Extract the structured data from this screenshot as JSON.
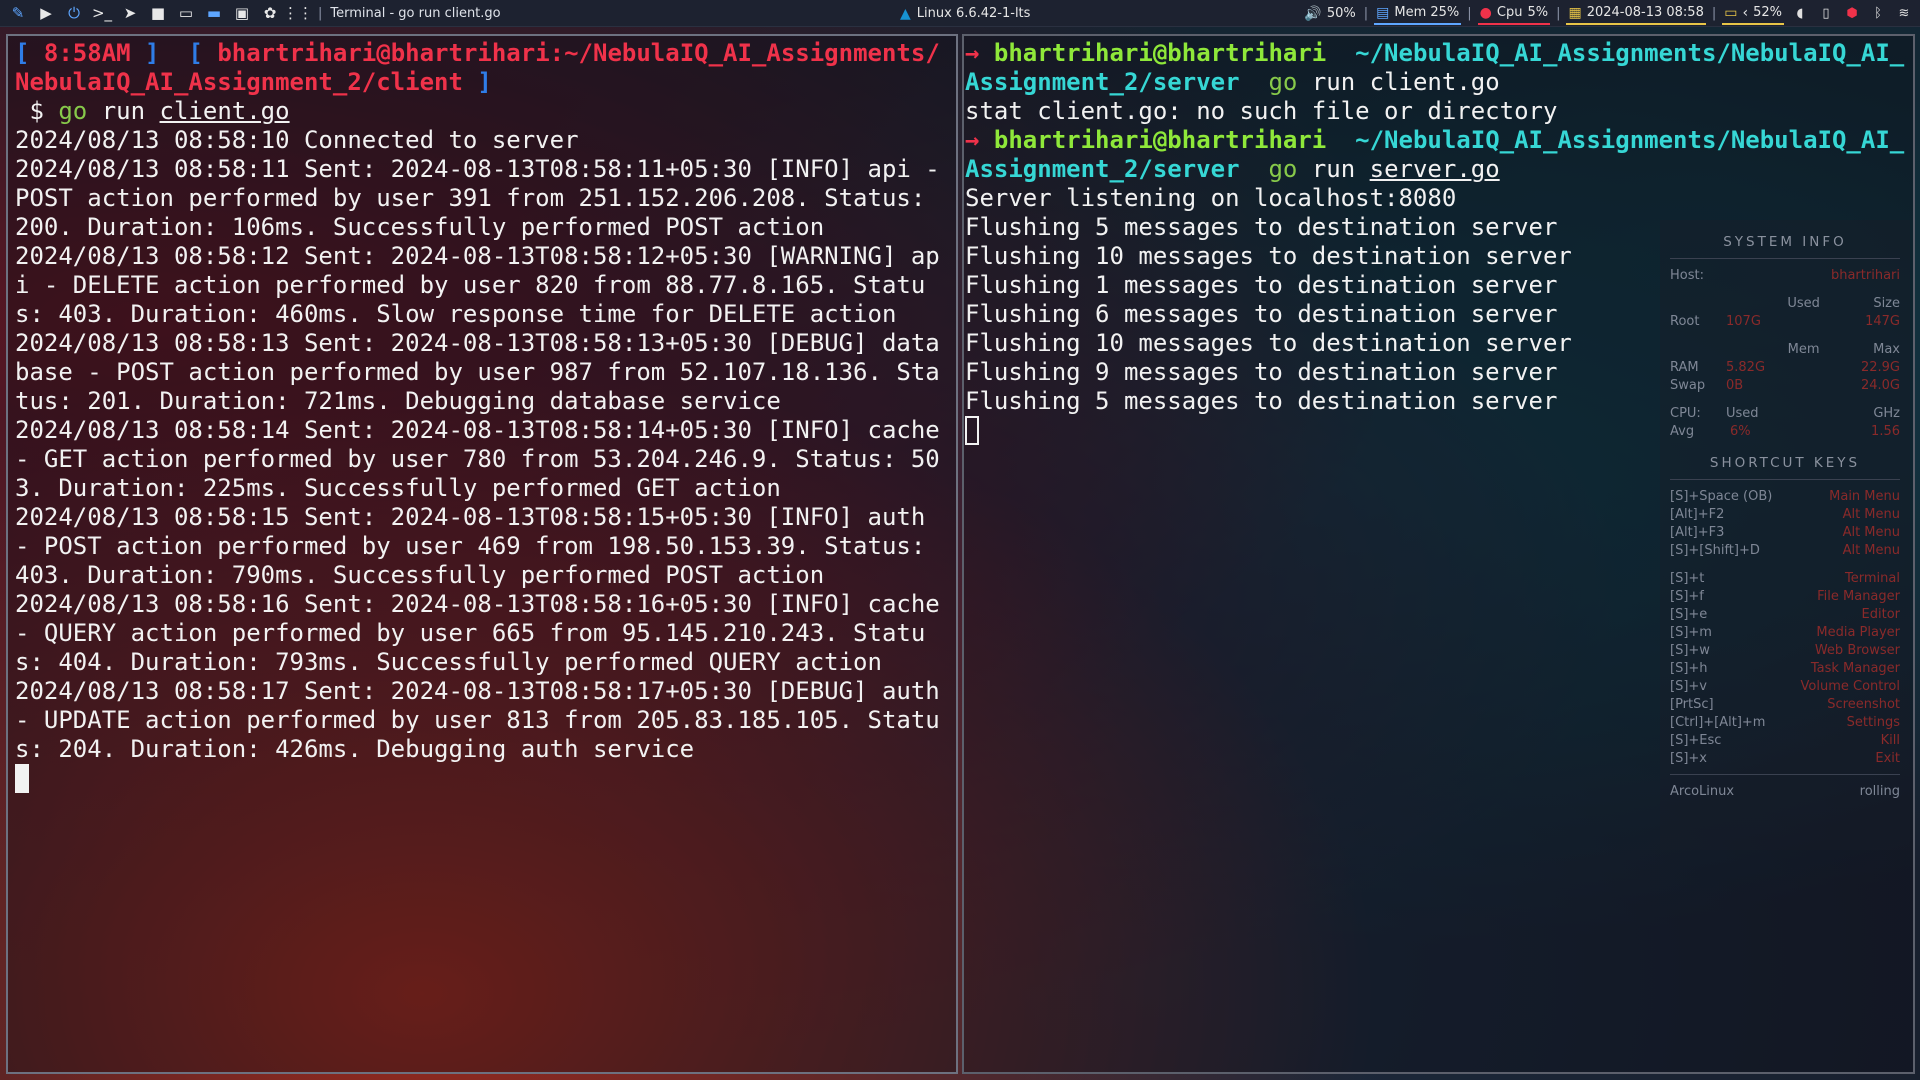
{
  "panel": {
    "window_title": "Terminal - go run client.go",
    "kernel": "Linux 6.6.42-1-lts",
    "volume": "50%",
    "mem": "Mem 25%",
    "cpu_label": "Cpu",
    "cpu_value": "5%",
    "datetime": "2024-08-13 08:58",
    "battery": "52%",
    "mem_color": "#5ea6ff",
    "cpu_color": "#f0324a",
    "date_color": "#e8c547",
    "battery_color": "#e8c547"
  },
  "left_terminal": {
    "prompt_time": "8:58AM",
    "prompt_path": "bhartrihari@bhartrihari:~/NebulaIQ_AI_Assignments/NebulaIQ_AI_Assignment_2/client",
    "prompt_symbol": "$",
    "cmd_go": "go",
    "cmd_run": "run",
    "cmd_file": "client.go",
    "lines": [
      "2024/08/13 08:58:10 Connected to server",
      "2024/08/13 08:58:11 Sent: 2024-08-13T08:58:11+05:30 [INFO] api - POST action performed by user 391 from 251.152.206.208. Status: 200. Duration: 106ms. Successfully performed POST action",
      "2024/08/13 08:58:12 Sent: 2024-08-13T08:58:12+05:30 [WARNING] api - DELETE action performed by user 820 from 88.77.8.165. Status: 403. Duration: 460ms. Slow response time for DELETE action",
      "2024/08/13 08:58:13 Sent: 2024-08-13T08:58:13+05:30 [DEBUG] database - POST action performed by user 987 from 52.107.18.136. Status: 201. Duration: 721ms. Debugging database service",
      "2024/08/13 08:58:14 Sent: 2024-08-13T08:58:14+05:30 [INFO] cache - GET action performed by user 780 from 53.204.246.9. Status: 503. Duration: 225ms. Successfully performed GET action",
      "2024/08/13 08:58:15 Sent: 2024-08-13T08:58:15+05:30 [INFO] auth - POST action performed by user 469 from 198.50.153.39. Status: 403. Duration: 790ms. Successfully performed POST action",
      "2024/08/13 08:58:16 Sent: 2024-08-13T08:58:16+05:30 [INFO] cache - QUERY action performed by user 665 from 95.145.210.243. Status: 404. Duration: 793ms. Successfully performed QUERY action",
      "2024/08/13 08:58:17 Sent: 2024-08-13T08:58:17+05:30 [DEBUG] auth - UPDATE action performed by user 813 from 205.83.185.105. Status: 204. Duration: 426ms. Debugging auth service"
    ]
  },
  "right_terminal": {
    "user_host": "bhartrihari@bhartrihari",
    "path": "~/NebulaIQ_AI_Assignments/NebulaIQ_AI_Assignment_2/server",
    "cmd1_file": "client.go",
    "error_line": "stat client.go: no such file or directory",
    "cmd2_file": "server.go",
    "cmd_go": "go",
    "cmd_run": "run",
    "lines": [
      "Server listening on localhost:8080",
      "Flushing 5 messages to destination server",
      "Flushing 10 messages to destination server",
      "Flushing 1 messages to destination server",
      "Flushing 6 messages to destination server",
      "Flushing 10 messages to destination server",
      "Flushing 9 messages to destination server",
      "Flushing 5 messages to destination server"
    ]
  },
  "conky": {
    "system_header": "SYSTEM INFO",
    "host_label": "Host:",
    "host_value": "bhartrihari",
    "disk_used_label": "Used",
    "disk_size_label": "Size",
    "root_label": "Root",
    "root_used": "107G",
    "root_size": "147G",
    "mem_label": "Mem",
    "max_label": "Max",
    "ram_label": "RAM",
    "ram_used": "5.82G",
    "ram_max": "22.9G",
    "swap_label": "Swap",
    "swap_used": "0B",
    "swap_max": "24.0G",
    "cpu_label": "CPU:",
    "cpu_used_label": "Used",
    "ghz_label": "GHz",
    "avg_label": "Avg",
    "cpu_avg": "6%",
    "cpu_ghz": "1.56",
    "shortcut_header": "SHORTCUT KEYS",
    "shortcuts_a": [
      {
        "key": "[S]+Space (OB)",
        "action": "Main Menu"
      },
      {
        "key": "[Alt]+F2",
        "action": "Alt Menu"
      },
      {
        "key": "[Alt]+F3",
        "action": "Alt Menu"
      },
      {
        "key": "[S]+[Shift]+D",
        "action": "Alt Menu"
      }
    ],
    "shortcuts_b": [
      {
        "key": "[S]+t",
        "action": "Terminal"
      },
      {
        "key": "[S]+f",
        "action": "File Manager"
      },
      {
        "key": "[S]+e",
        "action": "Editor"
      },
      {
        "key": "[S]+m",
        "action": "Media Player"
      },
      {
        "key": "[S]+w",
        "action": "Web Browser"
      },
      {
        "key": "[S]+h",
        "action": "Task Manager"
      },
      {
        "key": "[S]+v",
        "action": "Volume Control"
      },
      {
        "key": "[PrtSc]",
        "action": "Screenshot"
      },
      {
        "key": "[Ctrl]+[Alt]+m",
        "action": "Settings"
      },
      {
        "key": "[S]+Esc",
        "action": "Kill"
      },
      {
        "key": "[S]+x",
        "action": "Exit"
      }
    ],
    "distro": "ArcoLinux",
    "release": "rolling"
  }
}
